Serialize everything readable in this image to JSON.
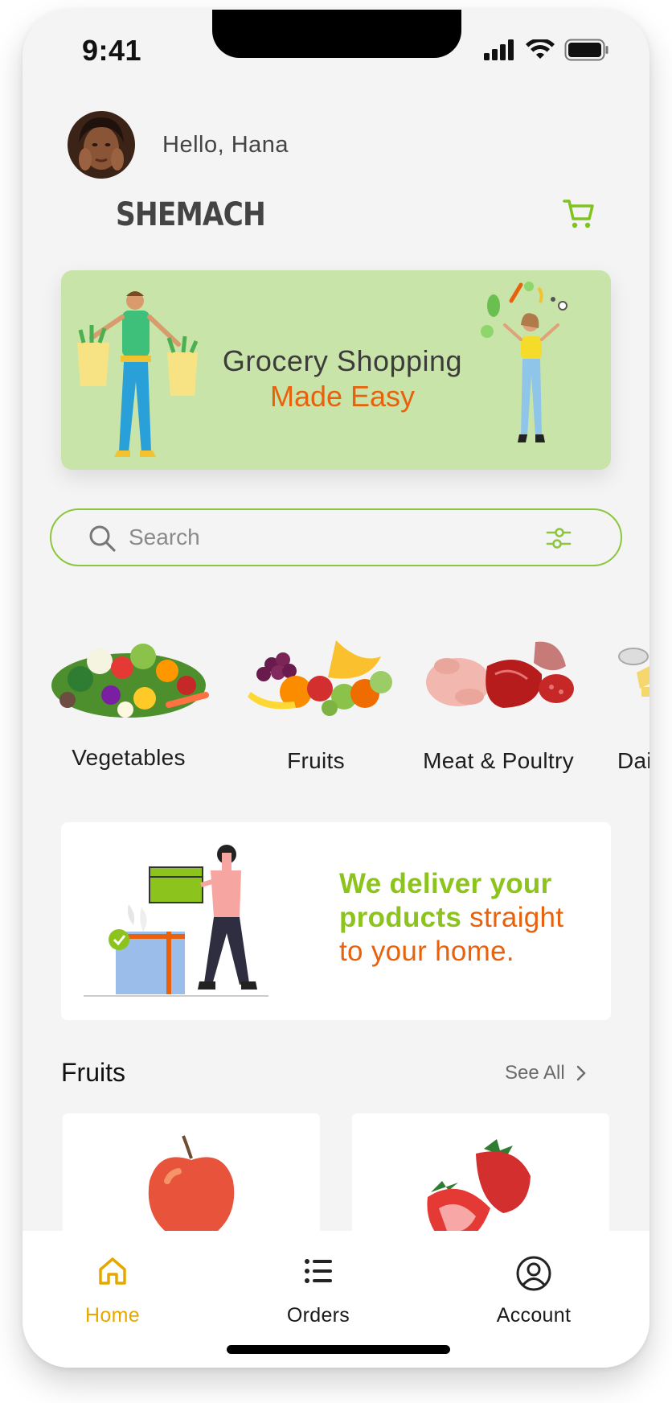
{
  "status": {
    "time": "9:41"
  },
  "header": {
    "greeting": "Hello, Hana",
    "brand": "SHEMACH"
  },
  "hero": {
    "title": "Grocery Shopping",
    "subtitle": "Made Easy"
  },
  "search": {
    "placeholder": "Search"
  },
  "categories": [
    {
      "label": "Vegetables"
    },
    {
      "label": "Fruits"
    },
    {
      "label": "Meat & Poultry"
    },
    {
      "label": "Dai"
    }
  ],
  "delivery_banner": {
    "line1": "We deliver your",
    "line2a": "products ",
    "line2b": "straight",
    "line3": "to your home."
  },
  "section": {
    "title": "Fruits",
    "see_all": "See All"
  },
  "tabs": [
    {
      "label": "Home",
      "active": true
    },
    {
      "label": "Orders",
      "active": false
    },
    {
      "label": "Account",
      "active": false
    }
  ],
  "colors": {
    "accent_green": "#8cc63f",
    "accent_orange": "#e8620e",
    "active_tab": "#e6a800",
    "hero_bg": "#c9e4a8"
  }
}
